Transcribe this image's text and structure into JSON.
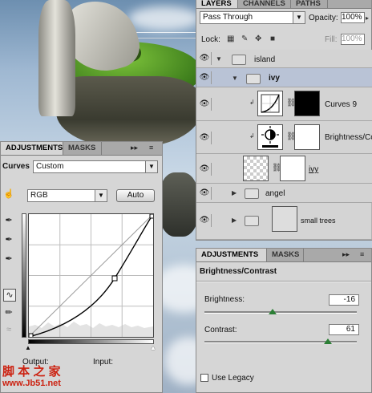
{
  "layers_panel": {
    "tabs": [
      "LAYERS",
      "CHANNELS",
      "PATHS"
    ],
    "blend_mode": "Pass Through",
    "opacity_label": "Opacity:",
    "opacity_value": "100%",
    "lock_label": "Lock:",
    "fill_label": "Fill:",
    "fill_value": "100%",
    "layers": [
      {
        "name": "island",
        "type": "group",
        "expanded": true
      },
      {
        "name": "ivy",
        "type": "group",
        "expanded": true,
        "selected": true
      },
      {
        "name": "Curves 9",
        "type": "adjustment",
        "icon": "curves-icon"
      },
      {
        "name": "Brightness/Co",
        "type": "adjustment",
        "icon": "brightness-icon"
      },
      {
        "name": "ivy",
        "type": "pixel"
      },
      {
        "name": "angel",
        "type": "group",
        "expanded": false
      },
      {
        "name": "small trees",
        "type": "group",
        "expanded": false
      }
    ]
  },
  "curves_panel": {
    "tabs": [
      "ADJUSTMENTS",
      "MASKS"
    ],
    "title": "Curves",
    "preset": "Custom",
    "channel": "RGB",
    "auto_button": "Auto",
    "output_label": "Output:",
    "input_label": "Input:"
  },
  "brightness_panel": {
    "tabs": [
      "ADJUSTMENTS",
      "MASKS"
    ],
    "title": "Brightness/Contrast",
    "brightness_label": "Brightness:",
    "brightness_value": "-16",
    "contrast_label": "Contrast:",
    "contrast_value": "61",
    "legacy_label": "Use Legacy"
  },
  "watermark": {
    "line1": "脚 本 之 家",
    "line2": "www.Jb51.net"
  },
  "colors": {
    "panel_bg": "#d6d6d6",
    "tab_bar": "#a9a9a9",
    "selected_row": "#b9c3d6",
    "slider_handle": "#2b7f35",
    "watermark": "#cc2211"
  }
}
